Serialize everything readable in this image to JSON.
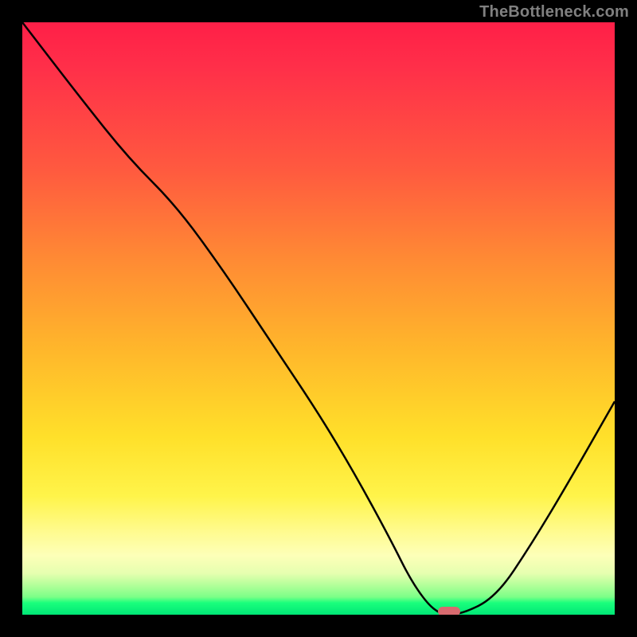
{
  "attribution": "TheBottleneck.com",
  "colors": {
    "page_bg": "#000000",
    "attribution_text": "#808080",
    "curve_stroke": "#000000",
    "marker_fill": "#d86a6f",
    "gradient_top": "#ff1f48",
    "gradient_bottom": "#00e676"
  },
  "chart_data": {
    "type": "line",
    "title": "",
    "xlabel": "",
    "ylabel": "",
    "xlim": [
      0,
      100
    ],
    "ylim": [
      0,
      100
    ],
    "grid": false,
    "legend": false,
    "series": [
      {
        "name": "bottleneck-curve",
        "x": [
          0,
          10,
          18,
          26,
          34,
          42,
          50,
          56,
          62,
          66,
          70,
          74,
          80,
          86,
          92,
          100
        ],
        "y": [
          100,
          87,
          77,
          69,
          58,
          46,
          34,
          24,
          13,
          5,
          0,
          0,
          3,
          12,
          22,
          36
        ]
      }
    ],
    "annotations": [
      {
        "name": "selected-point",
        "x": 72,
        "y": 0.6
      }
    ]
  }
}
